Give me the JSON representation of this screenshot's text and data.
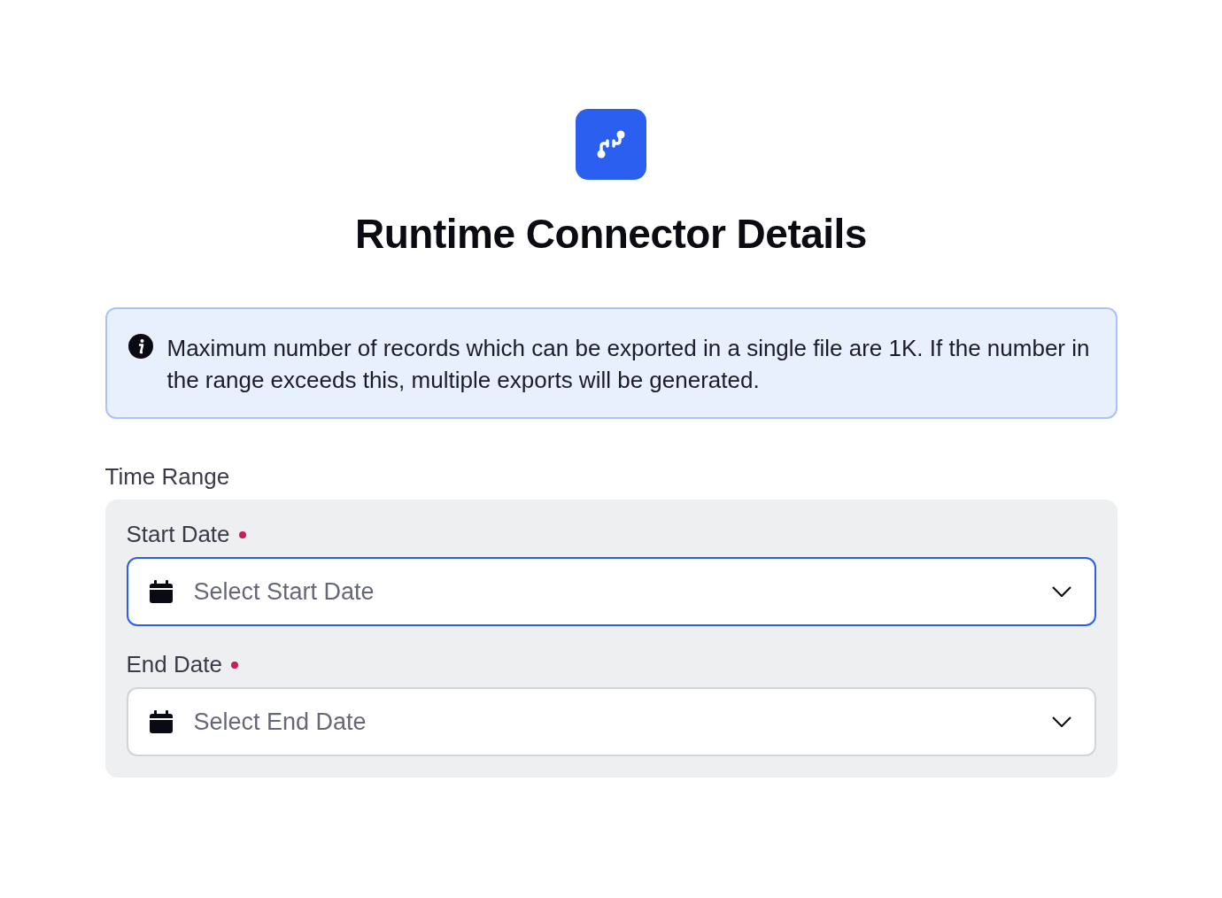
{
  "header": {
    "title": "Runtime Connector Details"
  },
  "info_banner": {
    "text": "Maximum number of records which can be exported in a single file are 1K. If the number in the range exceeds this, multiple exports will be generated."
  },
  "time_range": {
    "label": "Time Range",
    "fields": [
      {
        "label": "Start Date",
        "required": true,
        "placeholder": "Select Start Date",
        "focused": true
      },
      {
        "label": "End Date",
        "required": true,
        "placeholder": "Select End Date",
        "focused": false
      }
    ]
  }
}
